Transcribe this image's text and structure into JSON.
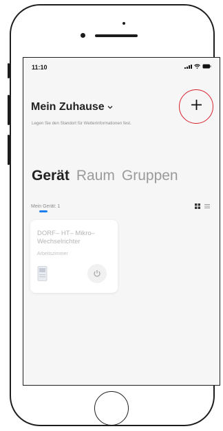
{
  "status_bar": {
    "time": "11:10"
  },
  "header": {
    "home_name": "Mein Zuhause",
    "weather_hint": "Legen Sie den Standort für Wetterinformationen fest.",
    "add_icon": "plus-icon"
  },
  "tabs": [
    {
      "label": "Gerät",
      "active": true
    },
    {
      "label": "Raum",
      "active": false
    },
    {
      "label": "Gruppen",
      "active": false
    }
  ],
  "device_count": {
    "label": "Mein Gerät: 1"
  },
  "devices": [
    {
      "name": "DORF– HT– Mikro– Wechselrichter",
      "room": "Arbeitszimmer",
      "power_icon": "power-icon"
    }
  ],
  "colors": {
    "accent": "#1e80f0",
    "highlight_ring": "#d8202a",
    "background": "#f6f6f7"
  }
}
